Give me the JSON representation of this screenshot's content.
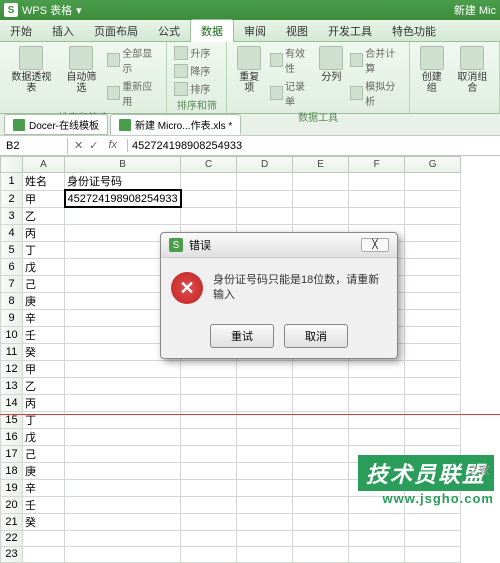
{
  "app": {
    "name": "WPS 表格",
    "logo": "S",
    "doc_title": "新建 Mic"
  },
  "tabs": [
    "开始",
    "插入",
    "页面布局",
    "公式",
    "数据",
    "审阅",
    "视图",
    "开发工具",
    "特色功能"
  ],
  "active_tab": 4,
  "ribbon_groups": {
    "g1": {
      "label": "",
      "btn1": "数据透视表",
      "btn2": "自动筛选",
      "s1": "全部显示",
      "s2": "重新应用"
    },
    "g2": {
      "label": "排序和筛选",
      "s1": "升序",
      "s2": "降序",
      "btn": "排序"
    },
    "g3": {
      "label": "数据工具",
      "btn": "重复项",
      "s1": "有效性",
      "s2": "记录单",
      "s3": "合并计算",
      "s4": "模拟分析",
      "btn2": "分列"
    },
    "g4": {
      "label": "",
      "btn1": "创建组",
      "btn2": "取消组合"
    }
  },
  "doctabs": [
    {
      "icon": "w",
      "label": "Docer-在线模板"
    },
    {
      "icon": "s",
      "label": "新建 Micro...作表.xls *"
    }
  ],
  "active_doctab": 1,
  "cellref": "B2",
  "formula": "452724198908254933",
  "cols": [
    "A",
    "B",
    "C",
    "D",
    "E",
    "F",
    "G"
  ],
  "data": {
    "A1": "姓名",
    "B1": "身份证号码",
    "A2": "甲",
    "B2": "452724198908254933",
    "A3": "乙",
    "A4": "丙",
    "A5": "丁",
    "A6": "戊",
    "A7": "己",
    "A8": "庚",
    "A9": "辛",
    "A10": "壬",
    "A11": "癸",
    "A12": "甲",
    "A13": "乙",
    "A14": "丙",
    "A15": "丁",
    "A16": "戊",
    "A17": "己",
    "A18": "庚",
    "A19": "辛",
    "A20": "壬",
    "A21": "癸"
  },
  "rows": 23,
  "dialog": {
    "title": "错误",
    "msg": "身份证号码只能是18位数，请重新输入",
    "retry": "重试",
    "cancel": "取消",
    "close": "╳"
  },
  "watermark": {
    "line1": "技术员联盟",
    "line2": "www.jsgho.com",
    "line3": "之家"
  },
  "fx": {
    "x": "✕",
    "check": "✓",
    "fx": "fx"
  }
}
